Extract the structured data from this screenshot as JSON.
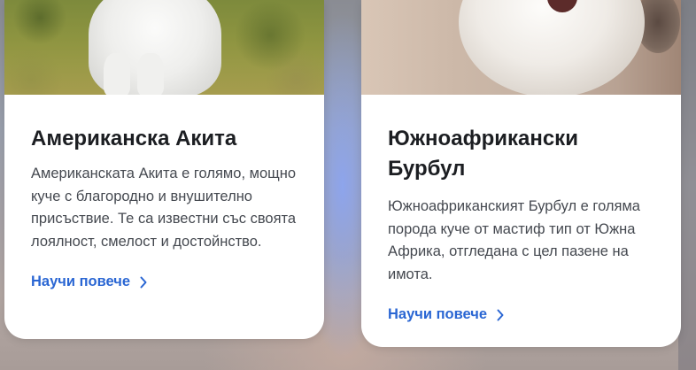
{
  "cards": [
    {
      "title": "Американска Акита",
      "description": "Американската Акита е голямо, мощно куче с благородно и внушително присъствие. Те са известни със своята лоялност, смелост и достойнство.",
      "link_label": "Научи повече",
      "link_icon": "chevron-right-icon"
    },
    {
      "title": "Южноафрикански Бурбул",
      "description": "Южноафриканският Бурбул е голяма порода куче от мастиф тип от Южна Африка, отгледана с цел пазене на имота.",
      "link_label": "Научи повече",
      "link_icon": "chevron-right-icon"
    }
  ],
  "colors": {
    "link": "#2a66d3",
    "title": "#1c1e22",
    "text": "#454950",
    "card_bg": "#ffffff"
  }
}
